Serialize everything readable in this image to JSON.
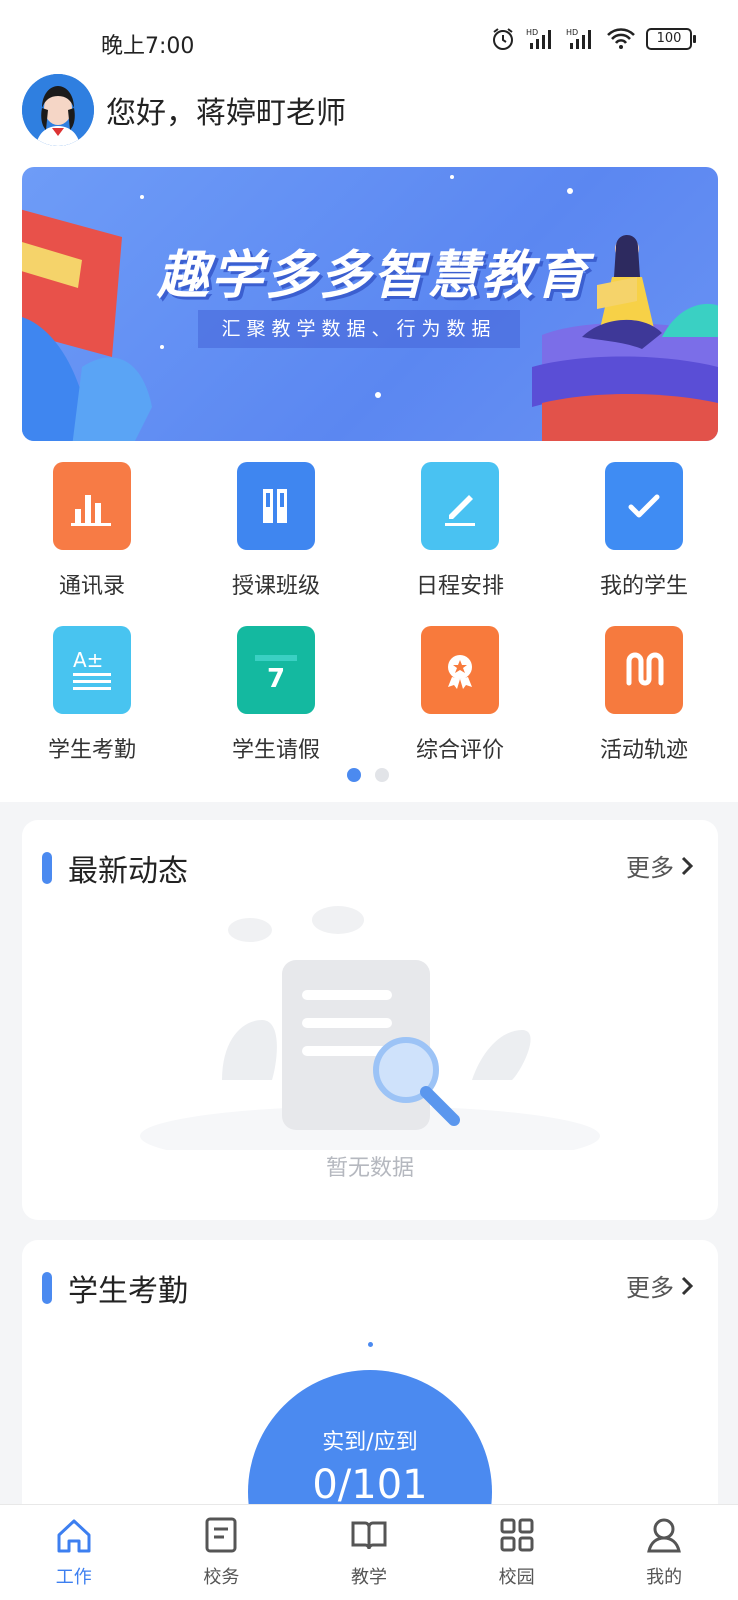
{
  "status_bar": {
    "time": "晚上7:00",
    "battery": "100"
  },
  "header": {
    "greeting": "您好，蒋婷町老师"
  },
  "banner": {
    "title": "趣学多多智慧教育",
    "subtitle": "汇聚教学数据、行为数据"
  },
  "grid": {
    "items": [
      {
        "label": "通讯录",
        "icon": "contacts-icon",
        "color": "#f77b45"
      },
      {
        "label": "授课班级",
        "icon": "books-icon",
        "color": "#3f86f0"
      },
      {
        "label": "日程安排",
        "icon": "pencil-note-icon",
        "color": "#49c2f2"
      },
      {
        "label": "我的学生",
        "icon": "check-file-icon",
        "color": "#3f8cf3"
      },
      {
        "label": "学生考勤",
        "icon": "grade-icon",
        "color": "#48c4f0"
      },
      {
        "label": "学生请假",
        "icon": "calendar-icon",
        "color": "#14b9a0"
      },
      {
        "label": "综合评价",
        "icon": "award-icon",
        "color": "#f87a3c"
      },
      {
        "label": "活动轨迹",
        "icon": "track-icon",
        "color": "#f67a3e"
      }
    ]
  },
  "pager": {
    "pages": 2,
    "current": 1
  },
  "news": {
    "title": "最新动态",
    "more": "更多",
    "empty_text": "暂无数据"
  },
  "attendance": {
    "title": "学生考勤",
    "more": "更多",
    "label": "实到/应到",
    "value": "0/101"
  },
  "tabbar": {
    "items": [
      {
        "label": "工作",
        "active": true
      },
      {
        "label": "校务",
        "active": false
      },
      {
        "label": "教学",
        "active": false
      },
      {
        "label": "校园",
        "active": false
      },
      {
        "label": "我的",
        "active": false
      }
    ]
  },
  "colors": {
    "accent": "#4b8af0",
    "tab_active": "#3d7ff0"
  }
}
